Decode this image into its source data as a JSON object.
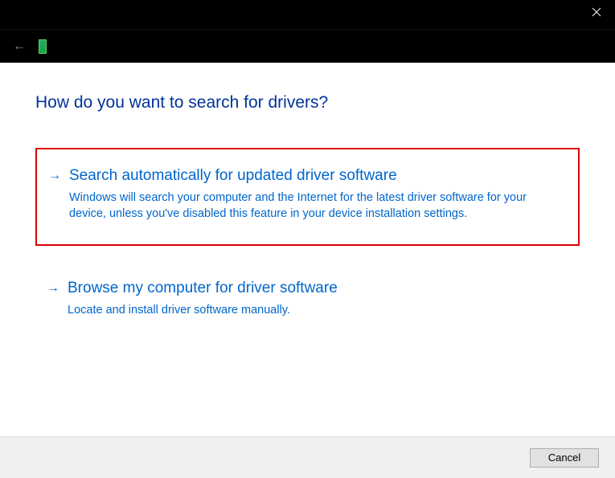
{
  "heading": "How do you want to search for drivers?",
  "options": [
    {
      "title": "Search automatically for updated driver software",
      "desc": "Windows will search your computer and the Internet for the latest driver software for your device, unless you've disabled this feature in your device installation settings."
    },
    {
      "title": "Browse my computer for driver software",
      "desc": "Locate and install driver software manually."
    }
  ],
  "footer": {
    "cancel": "Cancel"
  }
}
